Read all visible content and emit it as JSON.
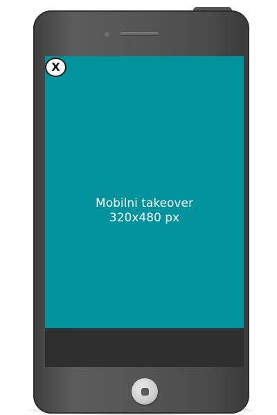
{
  "close_button": {
    "label": "X"
  },
  "ad": {
    "line1": "Mobilni takeover",
    "line2": "320x480 px"
  },
  "colors": {
    "ad_background": "#00939e",
    "phone_body": "#555555",
    "screen_bottom_bar": "#2f2f2f",
    "text": "#ffffff"
  },
  "icons": {
    "camera": "camera-dot-icon",
    "speaker": "speaker-grille-icon",
    "home": "home-button-icon"
  }
}
